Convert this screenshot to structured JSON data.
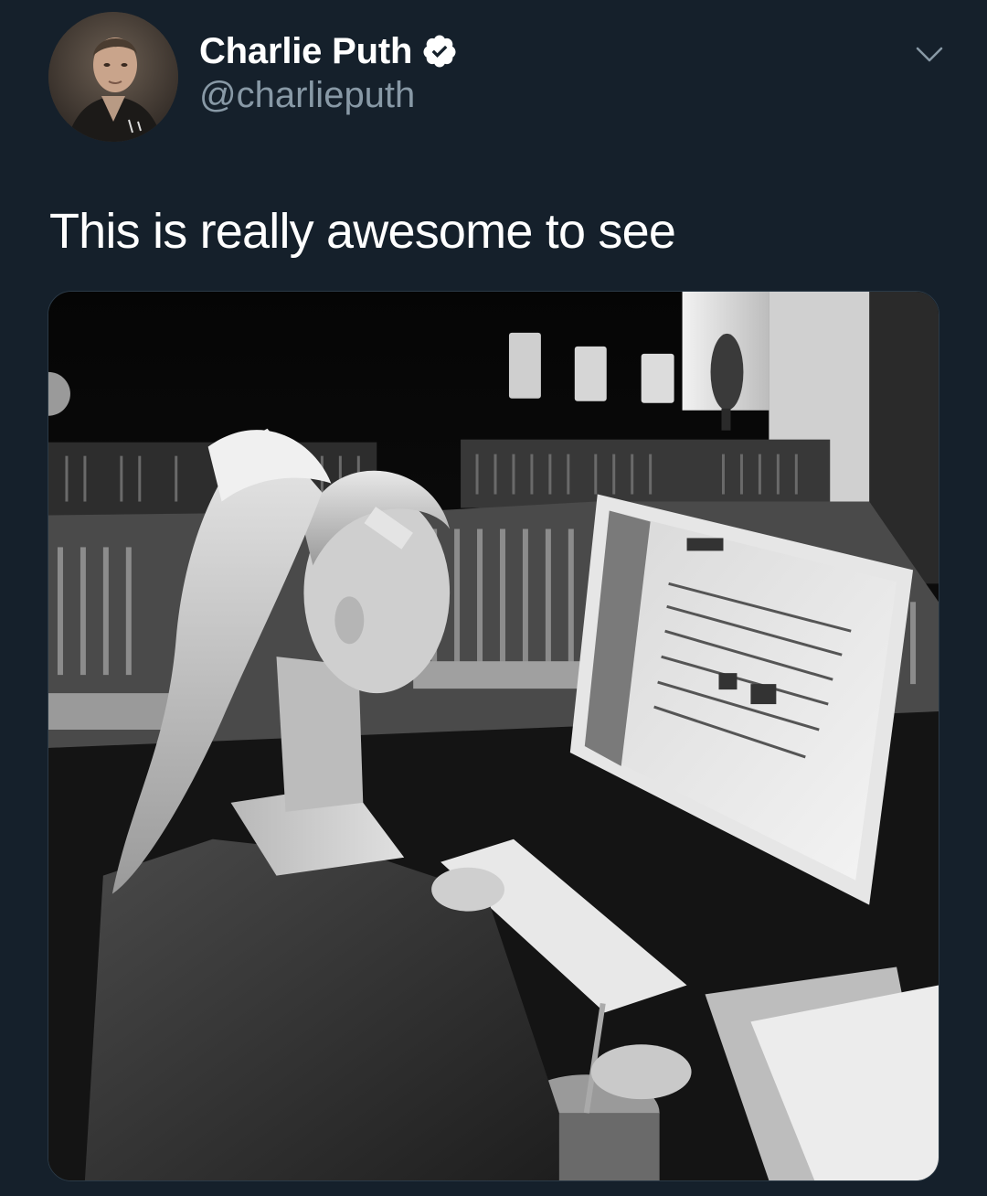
{
  "tweet": {
    "display_name": "Charlie Puth",
    "handle": "@charlieputh",
    "verified": true,
    "text": "This is really awesome to see",
    "icons": {
      "verified": "verified-badge-icon",
      "more": "chevron-down-icon"
    },
    "colors": {
      "background": "#15202b",
      "text": "#ffffff",
      "secondary_text": "#8899a6",
      "border": "#2b3a47"
    }
  }
}
